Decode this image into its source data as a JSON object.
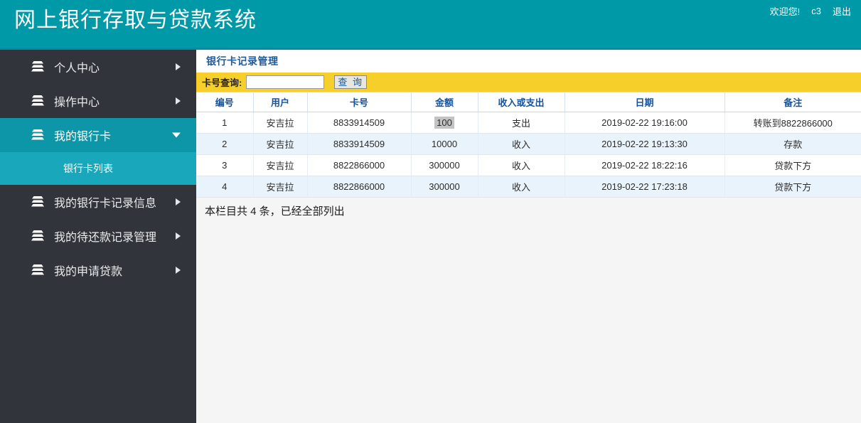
{
  "header": {
    "title": "网上银行存取与贷款系统",
    "welcome": "欢迎您!",
    "username": "c3",
    "logout": "退出",
    "bg_color": "#0099a8"
  },
  "sidebar": {
    "bg_color": "#31343a",
    "active_color": "#0d95a8",
    "subitem_color": "#19a7bb",
    "items": [
      {
        "label": "个人中心",
        "icon": "layers-icon",
        "arrow": "right",
        "active": false
      },
      {
        "label": "操作中心",
        "icon": "layers-icon",
        "arrow": "right",
        "active": false
      },
      {
        "label": "我的银行卡",
        "icon": "layers-icon",
        "arrow": "down",
        "active": true
      },
      {
        "label": "我的银行卡记录信息",
        "icon": "layers-icon",
        "arrow": "right",
        "active": false
      },
      {
        "label": "我的待还款记录管理",
        "icon": "layers-icon",
        "arrow": "right",
        "active": false
      },
      {
        "label": "我的申请贷款",
        "icon": "layers-icon",
        "arrow": "right",
        "active": false
      }
    ],
    "subitems": [
      {
        "label": "银行卡列表",
        "parent_index": 2
      }
    ]
  },
  "main": {
    "page_title": "银行卡记录管理",
    "search": {
      "label": "卡号查询:",
      "value": "",
      "placeholder": "",
      "button_label": "查 询",
      "bar_color": "#f7cf2a"
    },
    "table": {
      "columns": [
        "编号",
        "用户",
        "卡号",
        "金额",
        "收入或支出",
        "日期",
        "备注"
      ],
      "rows": [
        {
          "编号": "1",
          "用户": "安吉拉",
          "卡号": "8833914509",
          "金额": "100",
          "金额_highlighted": true,
          "收入或支出": "支出",
          "日期": "2019-02-22 19:16:00",
          "备注": "转账到8822866000"
        },
        {
          "编号": "2",
          "用户": "安吉拉",
          "卡号": "8833914509",
          "金额": "10000",
          "金额_highlighted": false,
          "收入或支出": "收入",
          "日期": "2019-02-22 19:13:30",
          "备注": "存款"
        },
        {
          "编号": "3",
          "用户": "安吉拉",
          "卡号": "8822866000",
          "金额": "300000",
          "金额_highlighted": false,
          "收入或支出": "收入",
          "日期": "2019-02-22 18:22:16",
          "备注": "贷款下方"
        },
        {
          "编号": "4",
          "用户": "安吉拉",
          "卡号": "8822866000",
          "金额": "300000",
          "金额_highlighted": false,
          "收入或支出": "收入",
          "日期": "2019-02-22 17:23:18",
          "备注": "贷款下方"
        }
      ]
    },
    "footer_text": "本栏目共 4 条，已经全部列出"
  }
}
